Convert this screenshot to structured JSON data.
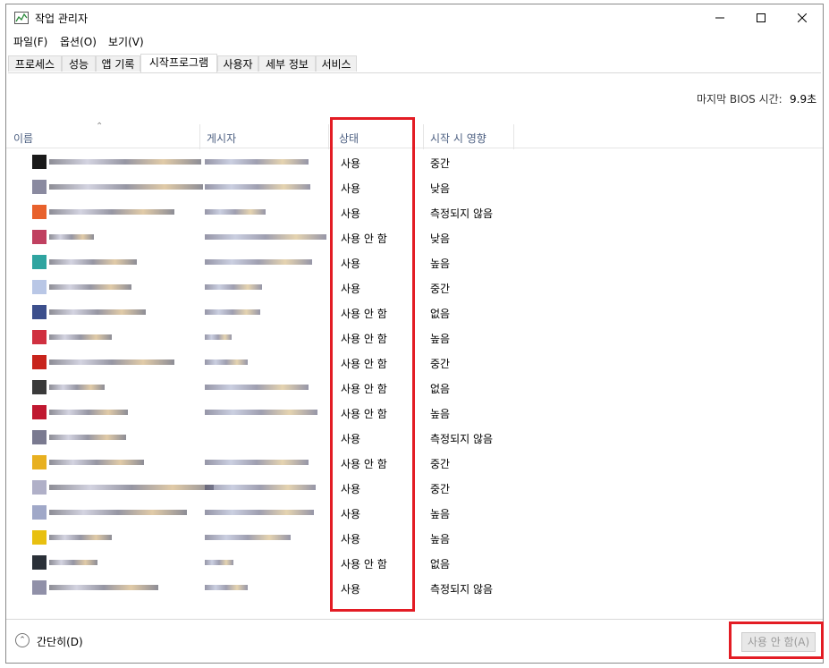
{
  "window": {
    "title": "작업 관리자"
  },
  "menu": [
    "파일(F)",
    "옵션(O)",
    "보기(V)"
  ],
  "tabs": [
    "프로세스",
    "성능",
    "앱 기록",
    "시작프로그램",
    "사용자",
    "세부 정보",
    "서비스"
  ],
  "bios": {
    "label": "마지막 BIOS 시간:",
    "value": "9.9초"
  },
  "columns": {
    "name": "이름",
    "publisher": "게시자",
    "status": "상태",
    "impact": "시작 시 영향"
  },
  "rows": [
    {
      "status": "사용",
      "impact": "중간",
      "icon_color": "#1a1a1a"
    },
    {
      "status": "사용",
      "impact": "낮음",
      "icon_color": "#8a8aa0"
    },
    {
      "status": "사용",
      "impact": "측정되지 않음",
      "icon_color": "#e8612c"
    },
    {
      "status": "사용 안 함",
      "impact": "낮음",
      "icon_color": "#c04060"
    },
    {
      "status": "사용",
      "impact": "높음",
      "icon_color": "#2fa4a0"
    },
    {
      "status": "사용",
      "impact": "중간",
      "icon_color": "#b9c7e6"
    },
    {
      "status": "사용 안 함",
      "impact": "없음",
      "icon_color": "#3c4f8c"
    },
    {
      "status": "사용 안 함",
      "impact": "높음",
      "icon_color": "#d03040"
    },
    {
      "status": "사용 안 함",
      "impact": "중간",
      "icon_color": "#c8241c"
    },
    {
      "status": "사용 안 함",
      "impact": "없음",
      "icon_color": "#3a3a3a"
    },
    {
      "status": "사용 안 함",
      "impact": "높음",
      "icon_color": "#c01830"
    },
    {
      "status": "사용",
      "impact": "측정되지 않음",
      "icon_color": "#7a7a90"
    },
    {
      "status": "사용 안 함",
      "impact": "중간",
      "icon_color": "#e8b020"
    },
    {
      "status": "사용",
      "impact": "중간",
      "icon_color": "#b0b0c8"
    },
    {
      "status": "사용",
      "impact": "높음",
      "icon_color": "#a0a8c8"
    },
    {
      "status": "사용",
      "impact": "높음",
      "icon_color": "#e8c010"
    },
    {
      "status": "사용 안 함",
      "impact": "없음",
      "icon_color": "#2a3038"
    },
    {
      "status": "사용",
      "impact": "측정되지 않음",
      "icon_color": "#9090a8"
    }
  ],
  "footer": {
    "collapse": "간단히(D)",
    "disable": "사용 안 함(A)"
  },
  "colors": {
    "highlight": "#e31c24",
    "header_text": "#4d6082"
  }
}
